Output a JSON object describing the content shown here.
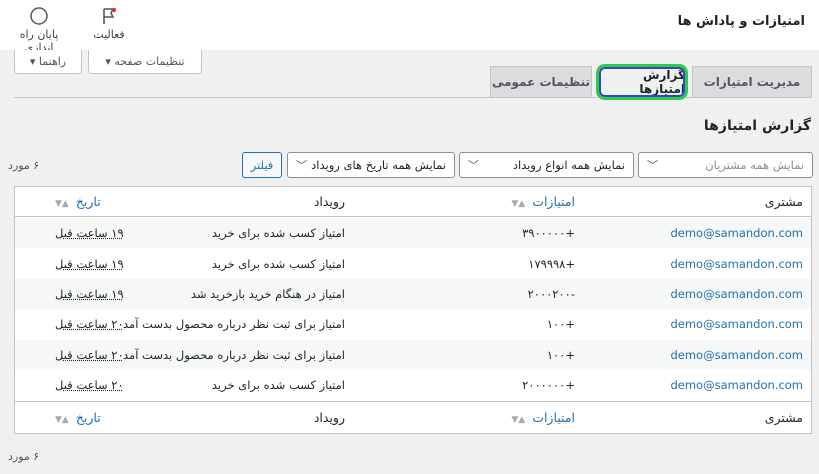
{
  "header": {
    "title": "امتیازات و پاداش ها",
    "actions": [
      {
        "label": "پایان راه اندازی",
        "icon": "circle-icon"
      },
      {
        "label": "فعالیت",
        "icon": "flag-icon"
      }
    ]
  },
  "screen_buttons": {
    "settings": "تنظیمات صفحه ▾",
    "help": "راهنما ▾"
  },
  "tabs": [
    {
      "label": "مدیریت امتیازات",
      "active": false
    },
    {
      "label": "گزارش امتیازها",
      "active": true
    },
    {
      "label": "تنظیمات عمومی",
      "active": false
    }
  ],
  "accent_colors": {
    "link": "#2271b1",
    "highlight_outer": "#2ecc40",
    "highlight_inner": "#3344dd"
  },
  "section_heading": "گزارش امتیازها",
  "filters": {
    "customers_placeholder": "نمایش همه مشتریان",
    "event_types": "نمایش همه انواع رویداد",
    "dates": "نمایش همه تاریخ های رویداد",
    "filter_button": "فیلتر"
  },
  "item_count": "۶ مورد",
  "table": {
    "columns": {
      "customer": "مشتری",
      "points": "امتیازات",
      "event": "رویداد",
      "date": "تاریخ"
    },
    "rows": [
      {
        "customer": "demo@samandon.com",
        "points": "+۳۹۰۰۰۰۰",
        "event": "امتیاز کسب شده برای خرید",
        "date": "۱۹ ساعت قبل"
      },
      {
        "customer": "demo@samandon.com",
        "points": "+۱۷۹۹۹۸",
        "event": "امتیاز کسب شده برای خرید",
        "date": "۱۹ ساعت قبل"
      },
      {
        "customer": "demo@samandon.com",
        "points": "-۲۰۰۰۲۰۰",
        "event": "امتیاز در هنگام خرید بازخرید شد",
        "date": "۱۹ ساعت قبل"
      },
      {
        "customer": "demo@samandon.com",
        "points": "+۱۰۰",
        "event": "امتیاز برای ثبت نظر درباره محصول بدست آمد",
        "date": "۲۰ ساعت قبل"
      },
      {
        "customer": "demo@samandon.com",
        "points": "+۱۰۰",
        "event": "امتیاز برای ثبت نظر درباره محصول بدست آمد",
        "date": "۲۰ ساعت قبل"
      },
      {
        "customer": "demo@samandon.com",
        "points": "+۲۰۰۰۰۰۰",
        "event": "امتیاز کسب شده برای خرید",
        "date": "۲۰ ساعت قبل"
      }
    ]
  }
}
